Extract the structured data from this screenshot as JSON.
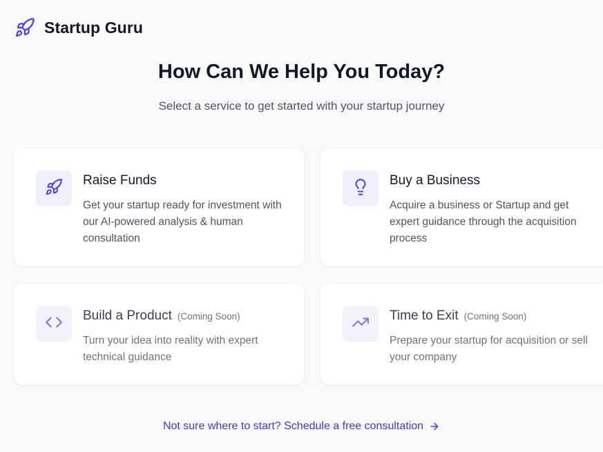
{
  "brand": {
    "name": "Startup Guru",
    "logo_icon": "rocket-icon",
    "accent_color": "#4f46e5"
  },
  "hero": {
    "title": "How Can We Help You Today?",
    "subtitle": "Select a service to get started with your startup journey"
  },
  "services": [
    {
      "title": "Raise Funds",
      "badge": "",
      "description": "Get your startup ready for investment with our AI-powered analysis & human consultation",
      "icon": "rocket-icon"
    },
    {
      "title": "Buy a Business",
      "badge": "",
      "description": "Acquire a business or Startup and get expert guidance through the acquisition process",
      "icon": "lightbulb-icon"
    },
    {
      "title": "Build a Product",
      "badge": "(Coming Soon)",
      "description": "Turn your idea into reality with expert technical guidance",
      "icon": "code-icon"
    },
    {
      "title": "Time to Exit",
      "badge": "(Coming Soon)",
      "description": "Prepare your startup for acquisition or sell your company",
      "icon": "trending-up-icon"
    }
  ],
  "footer": {
    "consultation_link": "Not sure where to start? Schedule a free consultation",
    "arrow_icon": "arrow-right-icon"
  }
}
